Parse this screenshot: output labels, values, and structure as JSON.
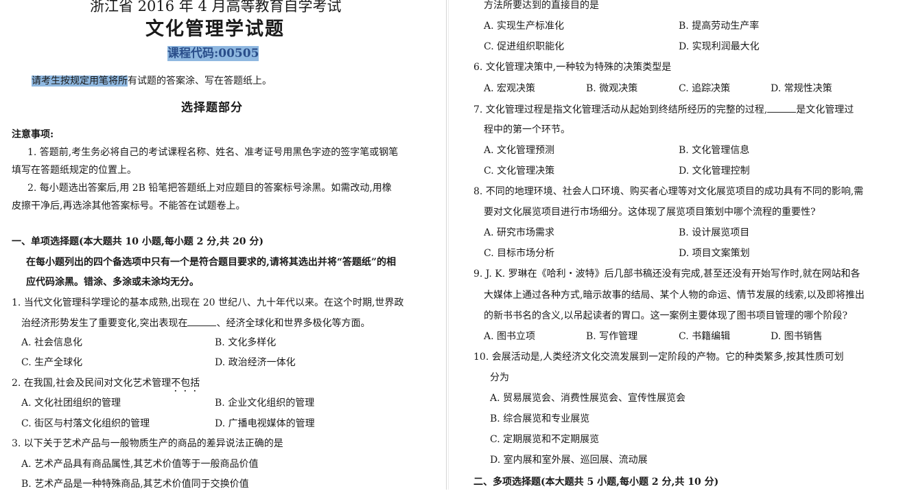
{
  "header": {
    "title_line1": "浙江省 2016 年 4 月高等教育自学考试",
    "title_line2": "文化管理学试题",
    "course_code": "课程代码:00505",
    "instruction_highlighted": "请考生按规定用笔将所",
    "instruction_rest": "有试题的答案涂、写在答题纸上。"
  },
  "section": {
    "name": "选择题部分",
    "notice_title": "注意事项:",
    "notice_1a": "1. 答题前,考生务必将自己的考试课程名称、姓名、准考证号用黑色字迹的签字笔或钢笔",
    "notice_1b": "填写在答题纸规定的位置上。",
    "notice_2a": "2. 每小题选出答案后,用 2B 铅笔把答题纸上对应题目的答案标号涂黑。如需改动,用橡",
    "notice_2b": "皮擦干净后,再选涂其他答案标号。不能答在试题卷上。"
  },
  "part1": {
    "heading": "一、单项选择题(本大题共 10 小题,每小题 2 分,共 20 分)",
    "desc_a": "在每小题列出的四个备选项中只有一个是符合题目要求的,请将其选出并将“答题纸”的相",
    "desc_b": "应代码涂黑。错涂、多涂或未涂均无分。"
  },
  "questions": {
    "q1": {
      "line1": "1. 当代文化管理科学理论的基本成熟,出现在 20 世纪八、九十年代以来。在这个时期,世界政",
      "line2a": "治经济形势发生了重要变化,突出表现在",
      "line2b": "、经济全球化和世界多极化等方面。",
      "a": "A. 社会信息化",
      "b": "B. 文化多样化",
      "c": "C. 生产全球化",
      "d": "D. 政治经济一体化"
    },
    "q2": {
      "stem": "2. 在我国,社会及民间对文化艺术管理",
      "stem_emph": "不包括",
      "a": "A. 文化社团组织的管理",
      "b": "B. 企业文化组织的管理",
      "c": "C. 街区与村落文化组织的管理",
      "d": "D. 广播电视媒体的管理"
    },
    "q3": {
      "stem": "3. 以下关于艺术产品与一般物质生产的商品的差异说法正确的是",
      "a": "A. 艺术产品具有商品属性,其艺术价值等于一般商品价值",
      "b": "B. 艺术产品是一种特殊商品,其艺术价值同于交换价值"
    },
    "q5": {
      "stem_tail": "方法所要达到的直接目的是",
      "a": "A. 实现生产标准化",
      "b": "B. 提高劳动生产率",
      "c": "C. 促进组织职能化",
      "d": "D. 实现利润最大化"
    },
    "q6": {
      "stem": "6. 文化管理决策中,一种较为特殊的决策类型是",
      "a": "A. 宏观决策",
      "b": "B. 微观决策",
      "c": "C. 追踪决策",
      "d": "D. 常规性决策"
    },
    "q7": {
      "line1a": "7. 文化管理过程是指文化管理活动从起始到终结所经历的完整的过程,",
      "line1b": "是文化管理过",
      "line2": "程中的第一个环节。",
      "a": "A. 文化管理预测",
      "b": "B. 文化管理信息",
      "c": "C. 文化管理决策",
      "d": "D. 文化管理控制"
    },
    "q8": {
      "line1": "8. 不同的地理环境、社会人口环境、购买者心理等对文化展览项目的成功具有不同的影响,需",
      "line2": "要对文化展览项目进行市场细分。这体现了展览项目策划中哪个流程的重要性?",
      "a": "A. 研究市场需求",
      "b": "B. 设计展览项目",
      "c": "C. 目标市场分析",
      "d": "D. 项目文案策划"
    },
    "q9": {
      "line1": "9. J. K. 罗琳在《哈利・波特》后几部书稿还没有完成,甚至还没有开始写作时,就在网站和各",
      "line2": "大媒体上通过各种方式,暗示故事的结局、某个人物的命运、情节发展的线索,以及即将推出",
      "line3": "的新书书名的含义,以吊起读者的胃口。这一案例主要体现了图书项目管理的哪个阶段?",
      "a": "A. 图书立项",
      "b": "B. 写作管理",
      "c": "C. 书籍编辑",
      "d": "D. 图书销售"
    },
    "q10": {
      "line1": "10. 会展活动是,人类经济文化交流发展到一定阶段的产物。它的种类繁多,按其性质可划",
      "line2": "分为",
      "a": "A. 贸易展览会、消费性展览会、宣传性展览会",
      "b": "B. 综合展览和专业展览",
      "c": "C. 定期展览和不定期展览",
      "d": "D. 室内展和室外展、巡回展、流动展"
    }
  },
  "part2": {
    "heading": "二、多项选择题(本大题共 5 小题,每小题 2 分,共 10 分)"
  }
}
